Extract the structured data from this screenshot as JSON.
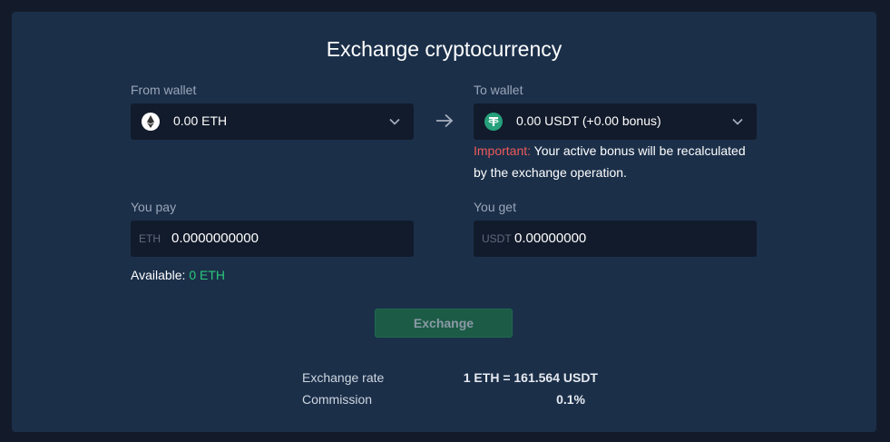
{
  "title": "Exchange cryptocurrency",
  "from_wallet": {
    "label": "From wallet",
    "coin_icon": "ethereum-icon",
    "selected": "0.00 ETH"
  },
  "to_wallet": {
    "label": "To wallet",
    "coin_icon": "tether-icon",
    "selected": "0.00 USDT (+0.00 bonus)"
  },
  "notice": {
    "important": "Important:",
    "text": " Your active bonus will be recalculated by the exchange operation."
  },
  "you_pay": {
    "label": "You pay",
    "unit": "ETH",
    "value": "0.0000000000"
  },
  "you_get": {
    "label": "You get",
    "unit": "USDT",
    "value": "0.00000000"
  },
  "available": {
    "label": "Available:",
    "value": "0 ETH"
  },
  "exchange_button": "Exchange",
  "info": {
    "rate_label": "Exchange rate",
    "rate_value": "1 ETH = 161.564 USDT",
    "commission_label": "Commission",
    "commission_value": "0.1%"
  },
  "colors": {
    "background": "#131b2b",
    "panel": "#1b2f49",
    "field": "#121b2b",
    "important": "#ef5a5a",
    "available_value": "#2bc77a",
    "button": "#1c5b45"
  }
}
